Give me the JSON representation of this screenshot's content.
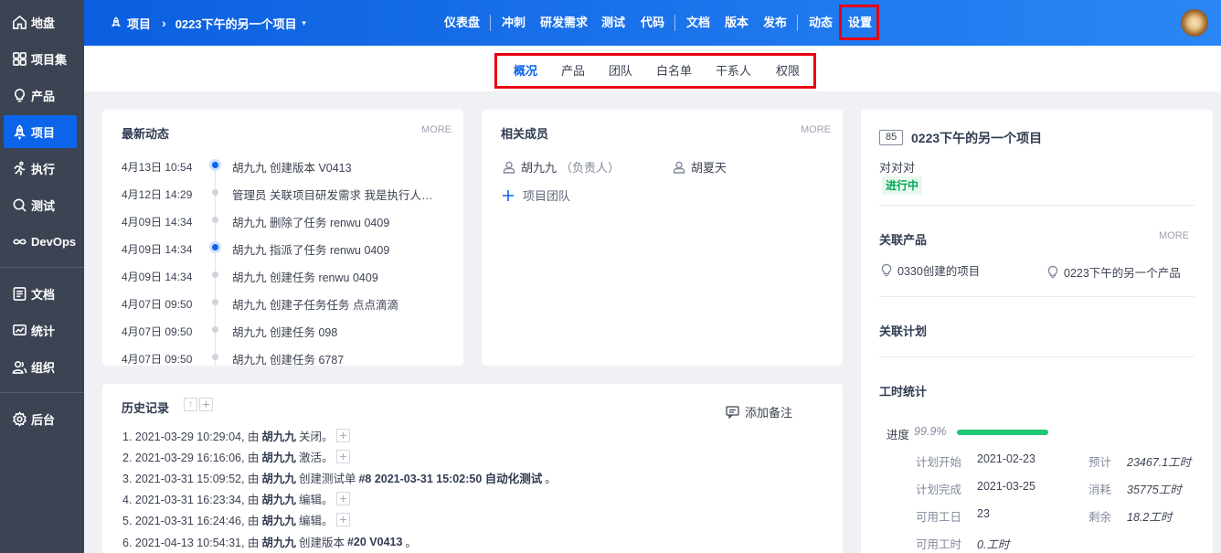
{
  "sidebar": {
    "items": [
      {
        "label": "地盘",
        "icon": "home-icon"
      },
      {
        "label": "项目集",
        "icon": "grid-icon"
      },
      {
        "label": "产品",
        "icon": "lightbulb-icon"
      },
      {
        "label": "项目",
        "icon": "rocket-icon"
      },
      {
        "label": "执行",
        "icon": "run-icon"
      },
      {
        "label": "测试",
        "icon": "magnifier-icon"
      },
      {
        "label": "DevOps",
        "icon": "infinity-icon"
      },
      {
        "label": "文档",
        "icon": "document-icon"
      },
      {
        "label": "统计",
        "icon": "chart-icon"
      },
      {
        "label": "组织",
        "icon": "people-icon"
      },
      {
        "label": "后台",
        "icon": "gear-icon"
      }
    ]
  },
  "header": {
    "breadcrumb_root": "项目",
    "breadcrumb_current": "0223下午的另一个项目",
    "nav": [
      "仪表盘",
      "冲刺",
      "研发需求",
      "测试",
      "代码",
      "文档",
      "版本",
      "发布",
      "动态",
      "设置"
    ]
  },
  "subnav": {
    "items": [
      "概况",
      "产品",
      "团队",
      "白名单",
      "干系人",
      "权限"
    ]
  },
  "activity": {
    "title": "最新动态",
    "more": "MORE",
    "items": [
      {
        "time": "4月13日 10:54",
        "text": "胡九九 创建版本 V0413"
      },
      {
        "time": "4月12日 14:29",
        "text": "管理员 关联项目研发需求 我是执行人员我..."
      },
      {
        "time": "4月09日 14:34",
        "text": "胡九九 删除了任务 renwu 0409"
      },
      {
        "time": "4月09日 14:34",
        "text": "胡九九 指派了任务 renwu 0409"
      },
      {
        "time": "4月09日 14:34",
        "text": "胡九九 创建任务 renwu 0409"
      },
      {
        "time": "4月07日 09:50",
        "text": "胡九九 创建子任务任务 点点滴滴"
      },
      {
        "time": "4月07日 09:50",
        "text": "胡九九 创建任务 098"
      },
      {
        "time": "4月07日 09:50",
        "text": "胡九九 创建任务 6787"
      }
    ]
  },
  "members": {
    "title": "相关成员",
    "more": "MORE",
    "list": [
      {
        "name": "胡九九",
        "role": "（负责人）"
      },
      {
        "name": "胡夏天",
        "role": ""
      }
    ],
    "team_link": "项目团队"
  },
  "history": {
    "title": "历史记录",
    "add_note": "添加备注",
    "entries": [
      {
        "pre": "1. 2021-03-29 10:29:04, 由",
        "user": "胡九九",
        "post": "关闭。",
        "plus": true
      },
      {
        "pre": "2. 2021-03-29 16:16:06, 由",
        "user": "胡九九",
        "post": "激活。",
        "plus": true
      },
      {
        "pre": "3. 2021-03-31 15:09:52, 由",
        "user": "胡九九",
        "post": "创建测试单",
        "bold_tail": "#8 2021-03-31 15:02:50 自动化测试",
        "tail": "。",
        "plus": false
      },
      {
        "pre": "4. 2021-03-31 16:23:34, 由",
        "user": "胡九九",
        "post": "编辑。",
        "plus": true
      },
      {
        "pre": "5. 2021-03-31 16:24:46, 由",
        "user": "胡九九",
        "post": "编辑。",
        "plus": true
      },
      {
        "pre": "6. 2021-04-13 10:54:31, 由",
        "user": "胡九九",
        "post": "创建版本",
        "bold_tail": "#20 V0413",
        "tail": "。",
        "plus": false
      }
    ]
  },
  "project": {
    "id": "85",
    "name": "0223下午的另一个项目",
    "desc": "对对对",
    "status": "进行中",
    "related_products_title": "关联产品",
    "more": "MORE",
    "products": [
      "0330创建的项目",
      "0223下午的另一个产品"
    ],
    "related_plans_title": "关联计划",
    "hours_title": "工时统计",
    "progress_label": "进度",
    "progress_value": "99.9%",
    "progress_fraction": 0.999,
    "stats": {
      "plan_start_label": "计划开始",
      "plan_start": "2021-02-23",
      "plan_end_label": "计划完成",
      "plan_end": "2021-03-25",
      "workdays_label": "可用工日",
      "workdays": "23",
      "workhours_label": "可用工时",
      "workhours": "0.工时",
      "estimate_label": "预计",
      "estimate": "23467.1工时",
      "consumed_label": "消耗",
      "consumed": "35775工时",
      "left_label": "剩余",
      "left": "18.2工时"
    }
  },
  "colors": {
    "accent": "#0c64eb",
    "sidebar": "#3c4353",
    "status_green": "#00a854",
    "progress": "#1ec771",
    "highlight": "#e60012"
  }
}
